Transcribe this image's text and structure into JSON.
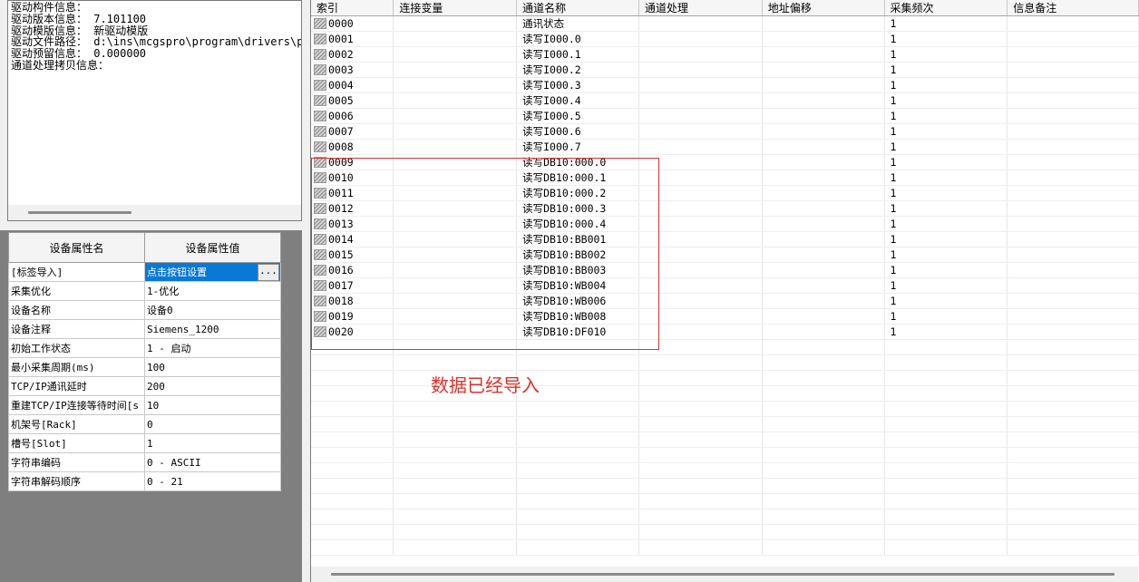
{
  "info_panel": {
    "lines": [
      "驱动构件信息：",
      "驱动版本信息： 7.101100",
      "驱动模版信息： 新驱动模版",
      "驱动文件路径： d:\\ins\\mcgspro\\program\\drivers\\pl",
      "驱动预留信息： 0.000000",
      "通道处理拷贝信息："
    ]
  },
  "device_props": {
    "header_name": "设备属性名",
    "header_value": "设备属性值",
    "button_label": "...",
    "rows": [
      {
        "name": "[标签导入]",
        "value": "点击按钮设置"
      },
      {
        "name": "采集优化",
        "value": "1-优化"
      },
      {
        "name": "设备名称",
        "value": "设备0"
      },
      {
        "name": "设备注释",
        "value": "Siemens_1200"
      },
      {
        "name": "初始工作状态",
        "value": "1 - 启动"
      },
      {
        "name": "最小采集周期(ms)",
        "value": "100"
      },
      {
        "name": "TCP/IP通讯延时",
        "value": "200"
      },
      {
        "name": "重建TCP/IP连接等待时间[s",
        "value": "10"
      },
      {
        "name": "机架号[Rack]",
        "value": "0"
      },
      {
        "name": "槽号[Slot]",
        "value": "1"
      },
      {
        "name": "字符串编码",
        "value": "0 - ASCII"
      },
      {
        "name": "字符串解码顺序",
        "value": "0 - 21"
      }
    ]
  },
  "channel_grid": {
    "columns": [
      "索引",
      "连接变量",
      "通道名称",
      "通道处理",
      "地址偏移",
      "采集频次",
      "信息备注"
    ],
    "rows": [
      {
        "index": "0000",
        "variable": "",
        "name": "通讯状态",
        "process": "",
        "offset": "",
        "freq": "1",
        "note": ""
      },
      {
        "index": "0001",
        "variable": "",
        "name": "读写I000.0",
        "process": "",
        "offset": "",
        "freq": "1",
        "note": ""
      },
      {
        "index": "0002",
        "variable": "",
        "name": "读写I000.1",
        "process": "",
        "offset": "",
        "freq": "1",
        "note": ""
      },
      {
        "index": "0003",
        "variable": "",
        "name": "读写I000.2",
        "process": "",
        "offset": "",
        "freq": "1",
        "note": ""
      },
      {
        "index": "0004",
        "variable": "",
        "name": "读写I000.3",
        "process": "",
        "offset": "",
        "freq": "1",
        "note": ""
      },
      {
        "index": "0005",
        "variable": "",
        "name": "读写I000.4",
        "process": "",
        "offset": "",
        "freq": "1",
        "note": ""
      },
      {
        "index": "0006",
        "variable": "",
        "name": "读写I000.5",
        "process": "",
        "offset": "",
        "freq": "1",
        "note": ""
      },
      {
        "index": "0007",
        "variable": "",
        "name": "读写I000.6",
        "process": "",
        "offset": "",
        "freq": "1",
        "note": ""
      },
      {
        "index": "0008",
        "variable": "",
        "name": "读写I000.7",
        "process": "",
        "offset": "",
        "freq": "1",
        "note": ""
      },
      {
        "index": "0009",
        "variable": "",
        "name": "读写DB10:000.0",
        "process": "",
        "offset": "",
        "freq": "1",
        "note": ""
      },
      {
        "index": "0010",
        "variable": "",
        "name": "读写DB10:000.1",
        "process": "",
        "offset": "",
        "freq": "1",
        "note": ""
      },
      {
        "index": "0011",
        "variable": "",
        "name": "读写DB10:000.2",
        "process": "",
        "offset": "",
        "freq": "1",
        "note": ""
      },
      {
        "index": "0012",
        "variable": "",
        "name": "读写DB10:000.3",
        "process": "",
        "offset": "",
        "freq": "1",
        "note": ""
      },
      {
        "index": "0013",
        "variable": "",
        "name": "读写DB10:000.4",
        "process": "",
        "offset": "",
        "freq": "1",
        "note": ""
      },
      {
        "index": "0014",
        "variable": "",
        "name": "读写DB10:BB001",
        "process": "",
        "offset": "",
        "freq": "1",
        "note": ""
      },
      {
        "index": "0015",
        "variable": "",
        "name": "读写DB10:BB002",
        "process": "",
        "offset": "",
        "freq": "1",
        "note": ""
      },
      {
        "index": "0016",
        "variable": "",
        "name": "读写DB10:BB003",
        "process": "",
        "offset": "",
        "freq": "1",
        "note": ""
      },
      {
        "index": "0017",
        "variable": "",
        "name": "读写DB10:WB004",
        "process": "",
        "offset": "",
        "freq": "1",
        "note": ""
      },
      {
        "index": "0018",
        "variable": "",
        "name": "读写DB10:WB006",
        "process": "",
        "offset": "",
        "freq": "1",
        "note": ""
      },
      {
        "index": "0019",
        "variable": "",
        "name": "读写DB10:WB008",
        "process": "",
        "offset": "",
        "freq": "1",
        "note": ""
      },
      {
        "index": "0020",
        "variable": "",
        "name": "读写DB10:DF010",
        "process": "",
        "offset": "",
        "freq": "1",
        "note": ""
      }
    ]
  },
  "annotation": {
    "text": "数据已经导入",
    "color": "#e0302a"
  },
  "colors": {
    "selection": "#0a78d7",
    "left_pane_bg": "#7f7f7f"
  }
}
